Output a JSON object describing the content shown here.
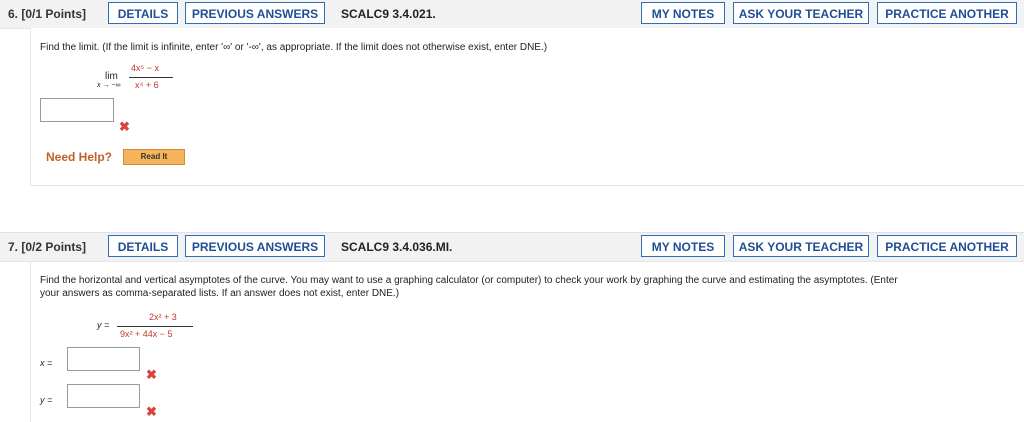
{
  "q6": {
    "number": "6.",
    "points": "[0/1 Points]",
    "details": "DETAILS",
    "previous_answers": "PREVIOUS ANSWERS",
    "code": "SCALC9 3.4.021.",
    "my_notes": "MY NOTES",
    "ask_teacher": "ASK YOUR TEACHER",
    "practice": "PRACTICE ANOTHER",
    "prompt": "Find the limit. (If the limit is infinite, enter '∞' or '-∞', as appropriate. If the limit does not otherwise exist, enter DNE.)",
    "lim": "lim",
    "lim_sub": "x → −∞",
    "numerator": "4x⁵ − x",
    "denominator": "x⁴ + 6",
    "answer_value": "",
    "status": "✖",
    "need_help": "Need Help?",
    "read_it": "Read It"
  },
  "q7": {
    "number": "7.",
    "points": "[0/2 Points]",
    "details": "DETAILS",
    "previous_answers": "PREVIOUS ANSWERS",
    "code": "SCALC9 3.4.036.MI.",
    "my_notes": "MY NOTES",
    "ask_teacher": "ASK YOUR TEACHER",
    "practice": "PRACTICE ANOTHER",
    "prompt_line1": "Find the horizontal and vertical asymptotes of the curve. You may want to use a graphing calculator (or computer) to check your work by graphing the curve and estimating the asymptotes. (Enter",
    "prompt_line2": "your answers as comma-separated lists. If an answer does not exist, enter DNE.)",
    "y_eq": "y =",
    "numerator": "2x² + 3",
    "denominator": "9x² + 44x − 5",
    "x_label": "x =",
    "y_label": "y =",
    "x_answer": "",
    "y_answer": "",
    "x_status": "✖",
    "y_status": "✖"
  }
}
